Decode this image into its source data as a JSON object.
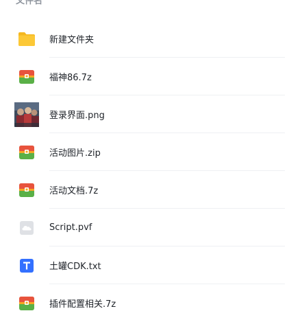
{
  "header": {
    "column_title": "文件名"
  },
  "files": [
    {
      "name": "新建文件夹",
      "icon": "folder-icon"
    },
    {
      "name": "福神86.7z",
      "icon": "archive-icon"
    },
    {
      "name": "登录界面.png",
      "icon": "image-thumbnail"
    },
    {
      "name": "活动图片.zip",
      "icon": "archive-icon"
    },
    {
      "name": "活动文档.7z",
      "icon": "archive-icon"
    },
    {
      "name": "Script.pvf",
      "icon": "cloud-file-icon"
    },
    {
      "name": "土罐CDK.txt",
      "icon": "text-file-icon"
    },
    {
      "name": "插件配置相关.7z",
      "icon": "archive-icon"
    }
  ],
  "colors": {
    "folder": "#fcc836",
    "archive_top": "#e8533d",
    "archive_bottom": "#5ab047",
    "archive_band": "#f5a623",
    "text_file": "#3370ff",
    "cloud_file": "#dfe1e5",
    "divider": "#eef0f3"
  }
}
